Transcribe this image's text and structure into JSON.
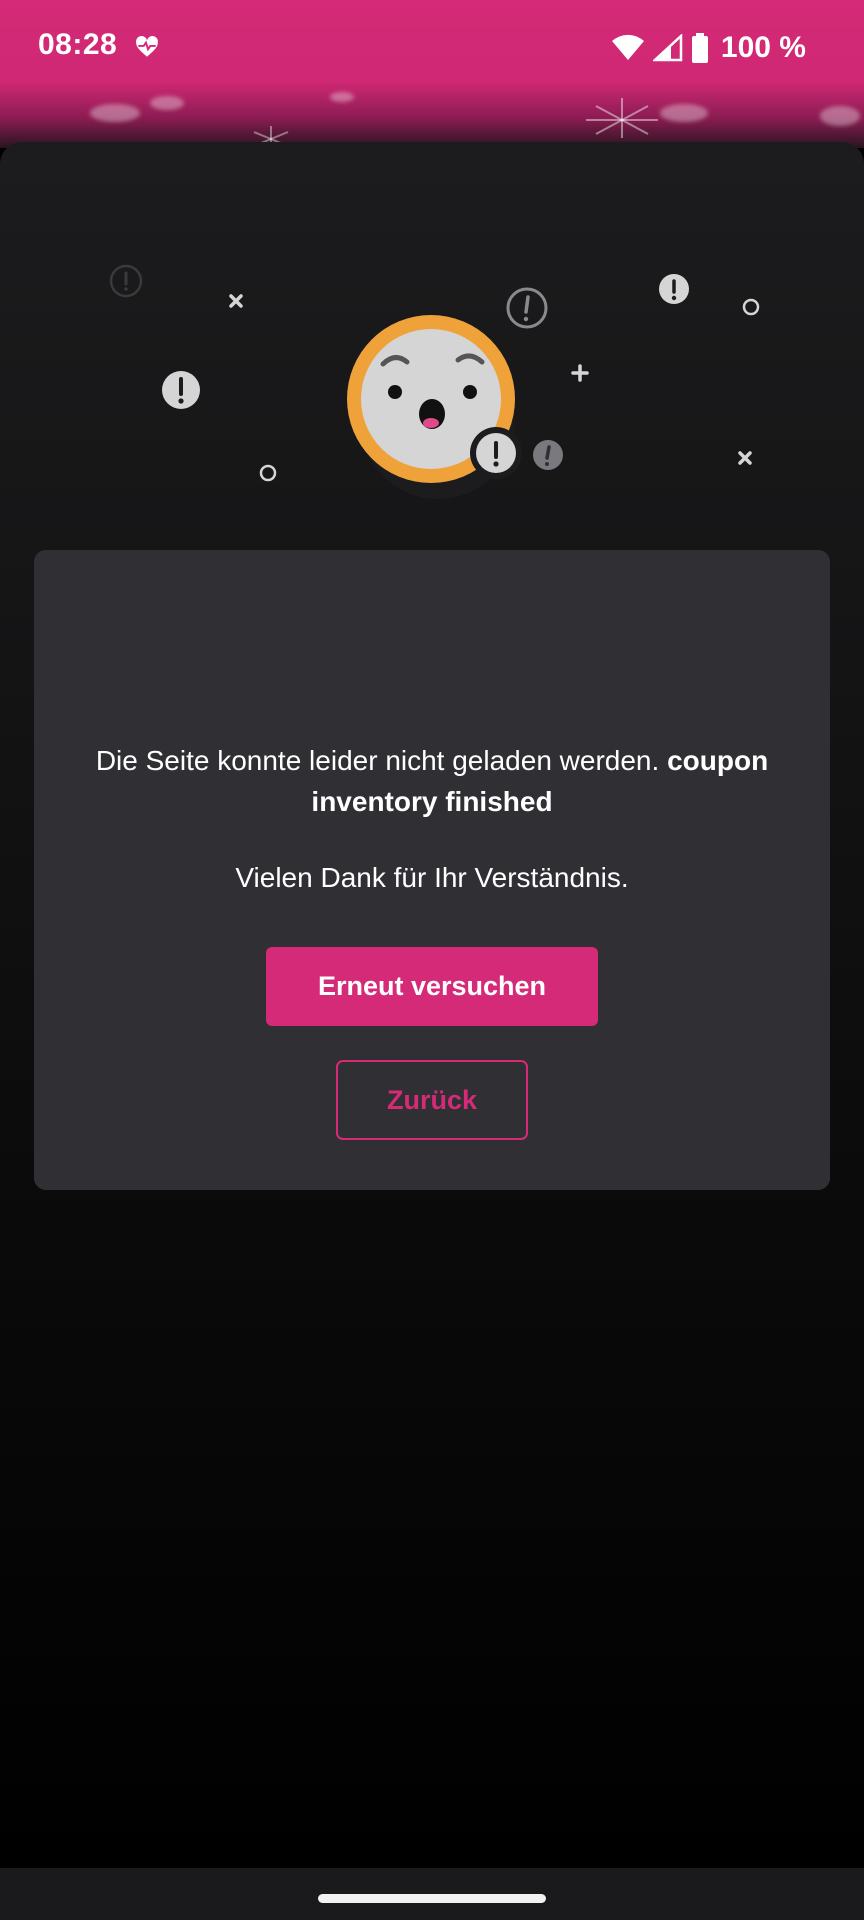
{
  "status_bar": {
    "time": "08:28",
    "battery_text": "100 %",
    "icons": [
      "heart-pulse-icon",
      "wifi-icon",
      "cell-signal-icon",
      "battery-icon"
    ]
  },
  "error": {
    "message_prefix": "Die Seite konnte leider nicht geladen werden. ",
    "message_bold": "coupon inventory finished",
    "thanks": "Vielen Dank für Ihr Verständnis."
  },
  "buttons": {
    "retry_label": "Erneut versuchen",
    "back_label": "Zurück"
  },
  "colors": {
    "accent": "#d42a77",
    "card": "#303034",
    "face": "#d5d5d5",
    "face_ring": "#f0a23a"
  }
}
